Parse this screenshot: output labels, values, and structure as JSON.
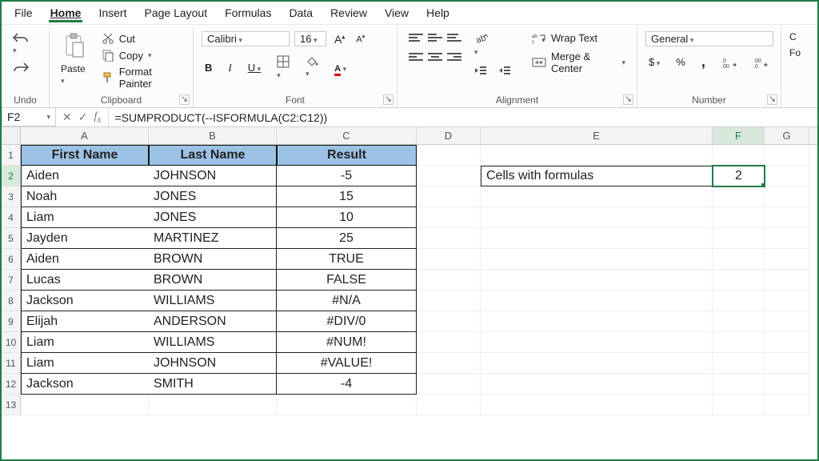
{
  "menubar": [
    "File",
    "Home",
    "Insert",
    "Page Layout",
    "Formulas",
    "Data",
    "Review",
    "View",
    "Help"
  ],
  "active_tab": "Home",
  "ribbon": {
    "undo_label": "Undo",
    "clipboard": {
      "paste": "Paste",
      "cut": "Cut",
      "copy": "Copy",
      "format_painter": "Format Painter",
      "group": "Clipboard"
    },
    "font": {
      "name": "Calibri",
      "size": "16",
      "group": "Font",
      "bold": "B",
      "italic": "I",
      "underline": "U"
    },
    "alignment": {
      "group": "Alignment",
      "wrap": "Wrap Text",
      "merge": "Merge & Center"
    },
    "number": {
      "group": "Number",
      "format": "General",
      "currency": "$",
      "percent": "%",
      "comma": ",",
      "inc_dec": ".0",
      "dec_inc": ".00"
    },
    "cells": "C",
    "format": "Fo"
  },
  "name_box": "F2",
  "formula": "=SUMPRODUCT(--ISFORMULA(C2:C12))",
  "columns": [
    "A",
    "B",
    "C",
    "D",
    "E",
    "F",
    "G"
  ],
  "col_widths": [
    "wA",
    "wB",
    "wC",
    "wD",
    "wE",
    "wF",
    "wG"
  ],
  "selected_cell": "F2",
  "table_header": [
    "First Name",
    "Last Name",
    "Result"
  ],
  "table_rows": [
    {
      "a": "Aiden",
      "b": "JOHNSON",
      "c": "-5"
    },
    {
      "a": "Noah",
      "b": "JONES",
      "c": "15"
    },
    {
      "a": "Liam",
      "b": "JONES",
      "c": "10"
    },
    {
      "a": "Jayden",
      "b": "MARTINEZ",
      "c": "25"
    },
    {
      "a": "Aiden",
      "b": "BROWN",
      "c": "TRUE"
    },
    {
      "a": "Lucas",
      "b": "BROWN",
      "c": "FALSE"
    },
    {
      "a": "Jackson",
      "b": "WILLIAMS",
      "c": "#N/A"
    },
    {
      "a": "Elijah",
      "b": "ANDERSON",
      "c": "#DIV/0"
    },
    {
      "a": "Liam",
      "b": "WILLIAMS",
      "c": "#NUM!"
    },
    {
      "a": "Liam",
      "b": "JOHNSON",
      "c": "#VALUE!"
    },
    {
      "a": "Jackson",
      "b": "SMITH",
      "c": "-4"
    }
  ],
  "side_label": "Cells with formulas",
  "side_value": "2",
  "row_count": 13,
  "chart_data": {
    "type": "table",
    "title": "",
    "columns": [
      "First Name",
      "Last Name",
      "Result"
    ],
    "rows": [
      [
        "Aiden",
        "JOHNSON",
        "-5"
      ],
      [
        "Noah",
        "JONES",
        "15"
      ],
      [
        "Liam",
        "JONES",
        "10"
      ],
      [
        "Jayden",
        "MARTINEZ",
        "25"
      ],
      [
        "Aiden",
        "BROWN",
        "TRUE"
      ],
      [
        "Lucas",
        "BROWN",
        "FALSE"
      ],
      [
        "Jackson",
        "WILLIAMS",
        "#N/A"
      ],
      [
        "Elijah",
        "ANDERSON",
        "#DIV/0"
      ],
      [
        "Liam",
        "WILLIAMS",
        "#NUM!"
      ],
      [
        "Liam",
        "JOHNSON",
        "#VALUE!"
      ],
      [
        "Jackson",
        "SMITH",
        "-4"
      ]
    ],
    "aux": {
      "Cells with formulas": 2
    }
  }
}
